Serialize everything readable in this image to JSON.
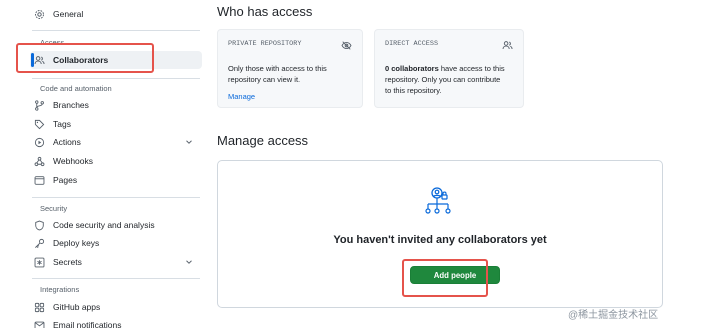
{
  "sidebar": {
    "general": "General",
    "access_label": "Access",
    "collaborators": "Collaborators",
    "code_label": "Code and automation",
    "branches": "Branches",
    "tags": "Tags",
    "actions": "Actions",
    "webhooks": "Webhooks",
    "pages": "Pages",
    "security_label": "Security",
    "code_security": "Code security and analysis",
    "deploy_keys": "Deploy keys",
    "secrets": "Secrets",
    "integrations_label": "Integrations",
    "github_apps": "GitHub apps",
    "email_notifications": "Email notifications"
  },
  "who": {
    "title": "Who has access",
    "private": {
      "heading": "PRIVATE REPOSITORY",
      "line1": "Only those with access to this",
      "line2": "repository can view it.",
      "link": "Manage"
    },
    "direct": {
      "heading": "DIRECT ACCESS",
      "line1_count": "0 collaborators",
      "line1_rest": " have access to this",
      "line2": "repository. Only you can contribute",
      "line3": "to this repository."
    }
  },
  "manage": {
    "title": "Manage access",
    "empty": "You haven't invited any collaborators yet",
    "button": "Add people"
  },
  "watermark": "@稀土掘金技术社区",
  "colors": {
    "accent": "#0969da",
    "primary_button": "#1f883d",
    "highlight": "#e5534b"
  }
}
